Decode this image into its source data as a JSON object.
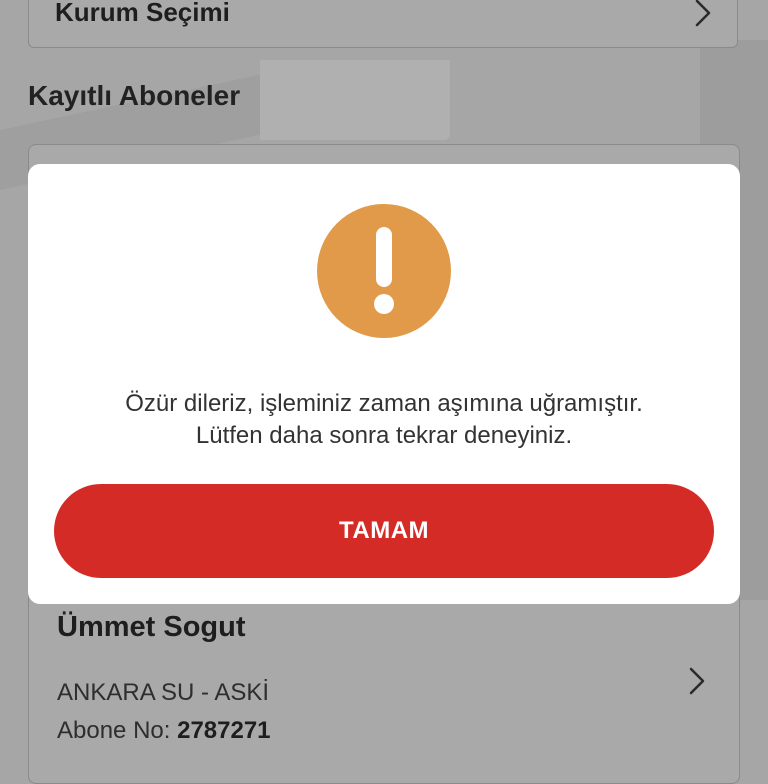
{
  "header": {
    "kurum_label": "Kurum Seçimi"
  },
  "saved_subscribers": {
    "title": "Kayıtlı Aboneler",
    "items": [
      {
        "name": "Ümmet Sogut",
        "institution": "ANKARA SU - ASKİ",
        "abone_label": "Abone No:",
        "abone_no": "2787271"
      }
    ]
  },
  "dialog": {
    "icon": "exclamation-icon",
    "icon_color": "#e19a4a",
    "message_line1": "Özür dileriz, işleminiz zaman aşımına uğramıştır.",
    "message_line2": "Lütfen daha sonra tekrar deneyiniz.",
    "button_label": "TAMAM",
    "button_color": "#d52b26"
  }
}
